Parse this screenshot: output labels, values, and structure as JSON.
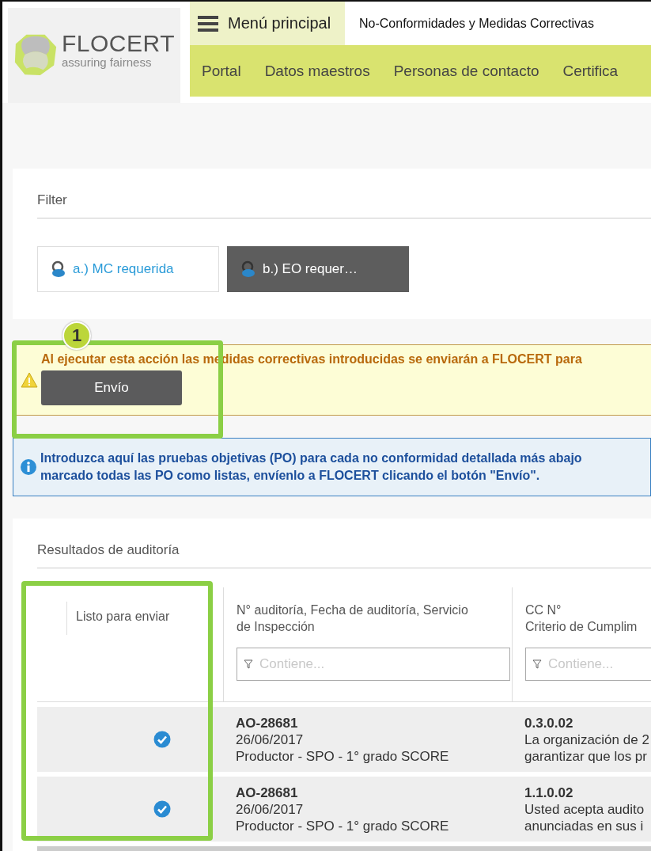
{
  "header": {
    "logo": {
      "name": "FLOCERT",
      "tagline": "assuring fairness"
    },
    "menu_label": "Menú principal",
    "page_title": "No-Conformidades y Medidas Correctivas"
  },
  "nav": [
    {
      "label": "Portal"
    },
    {
      "label": "Datos maestros"
    },
    {
      "label": "Personas de contacto"
    },
    {
      "label": "Certifica"
    }
  ],
  "filter": {
    "title": "Filter",
    "tabs": [
      {
        "label": "a.) MC requerida",
        "selected": false
      },
      {
        "label": "b.) EO requer…",
        "selected": true
      }
    ]
  },
  "warning": {
    "text": "Al ejecutar esta acción las medidas correctivas introducidas se enviarán a FLOCERT para",
    "button": "Envío",
    "badge": "1"
  },
  "info": {
    "lines": [
      "Introduzca aquí las pruebas objetivas (PO) para cada no conformidad detallada más abajo",
      "marcado todas las PO como listas, envíenlo a FLOCERT clicando el botón \"Envío\"."
    ]
  },
  "results": {
    "title": "Resultados de auditoría",
    "columns": [
      {
        "lines": [
          "Listo para enviar"
        ]
      },
      {
        "lines": [
          "N° auditoría, Fecha de auditoría, Servicio",
          "de Inspección"
        ],
        "filter_placeholder": "Contiene..."
      },
      {
        "lines": [
          "CC N°",
          "Criterio de Cumplim"
        ],
        "filter_placeholder": "Contiene..."
      }
    ],
    "rows": [
      {
        "ready": true,
        "audit": {
          "id": "AO-28681",
          "date": "26/06/2017",
          "service": "Productor - SPO - 1° grado SCORE"
        },
        "cc": {
          "id": "0.3.0.02",
          "lines": [
            "La organización de 2",
            "garantizar que los pr"
          ]
        }
      },
      {
        "ready": true,
        "audit": {
          "id": "AO-28681",
          "date": "26/06/2017",
          "service": "Productor - SPO - 1° grado SCORE"
        },
        "cc": {
          "id": "1.1.0.02",
          "lines": [
            "Usted acepta audito",
            "anunciadas en sus i"
          ]
        }
      }
    ]
  }
}
